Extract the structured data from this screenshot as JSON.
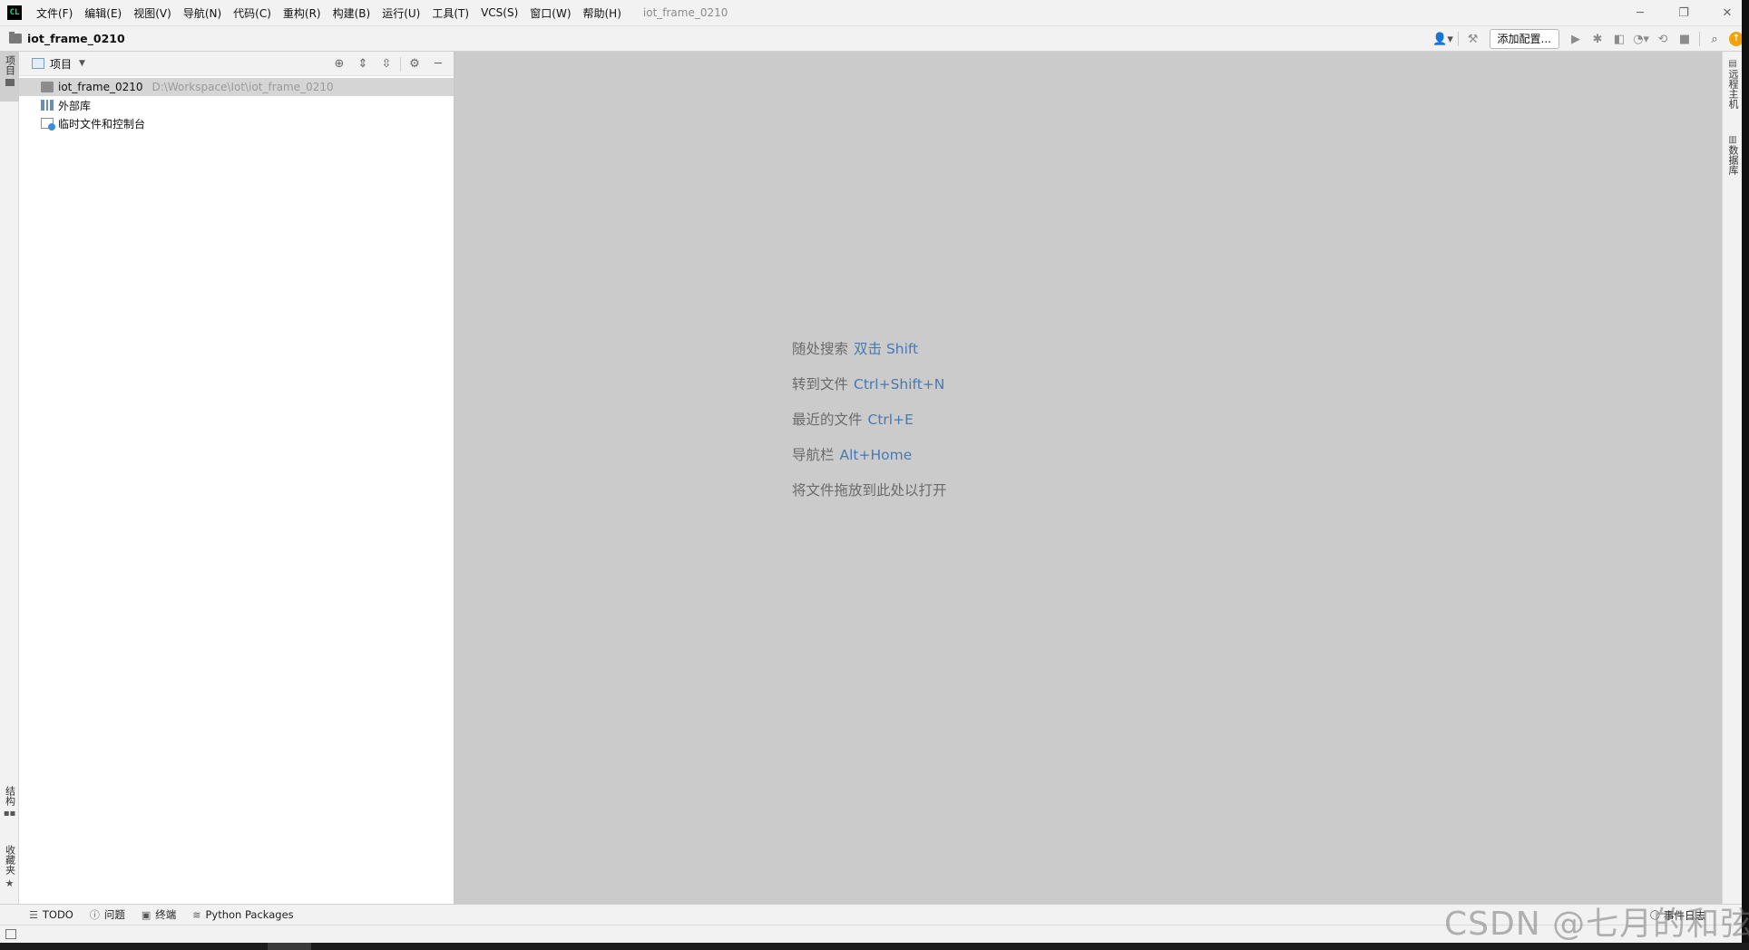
{
  "app": {
    "logo_text": "CL",
    "window_title": "iot_frame_0210"
  },
  "menu": [
    "文件(F)",
    "编辑(E)",
    "视图(V)",
    "导航(N)",
    "代码(C)",
    "重构(R)",
    "构建(B)",
    "运行(U)",
    "工具(T)",
    "VCS(S)",
    "窗口(W)",
    "帮助(H)"
  ],
  "window_controls": {
    "minimize": "─",
    "restore": "❐",
    "close": "✕"
  },
  "navbar": {
    "breadcrumb": "iot_frame_0210",
    "add_config_label": "添加配置..."
  },
  "left_stripe": {
    "project": "项目",
    "structure": "结构",
    "favorites": "收藏夹"
  },
  "right_stripe": {
    "remote_host": "远程主机",
    "database": "数据库"
  },
  "project_panel": {
    "title": "项目",
    "tree": [
      {
        "label": "iot_frame_0210",
        "path": "D:\\Workspace\\Iot\\iot_frame_0210",
        "icon": "folder-icon",
        "selected": true
      },
      {
        "label": "外部库",
        "path": "",
        "icon": "library-icon",
        "selected": false
      },
      {
        "label": "临时文件和控制台",
        "path": "",
        "icon": "scratch-icon",
        "selected": false
      }
    ]
  },
  "editor": {
    "hints": [
      {
        "text": "随处搜索",
        "key": "双击 Shift"
      },
      {
        "text": "转到文件",
        "key": "Ctrl+Shift+N"
      },
      {
        "text": "最近的文件",
        "key": "Ctrl+E"
      },
      {
        "text": "导航栏",
        "key": "Alt+Home"
      },
      {
        "text": "将文件拖放到此处以打开",
        "key": ""
      }
    ]
  },
  "bottom_tools": [
    {
      "label": "TODO",
      "icon": "list-icon"
    },
    {
      "label": "问题",
      "icon": "problems-icon"
    },
    {
      "label": "终端",
      "icon": "terminal-icon"
    },
    {
      "label": "Python Packages",
      "icon": "packages-icon"
    }
  ],
  "event_log_label": "事件日志",
  "watermark": "CSDN @七月的和弦",
  "colors": {
    "editor_bg": "#cbcbcb",
    "hint_key": "#4a79b0",
    "update_badge": "#f0a30a"
  }
}
